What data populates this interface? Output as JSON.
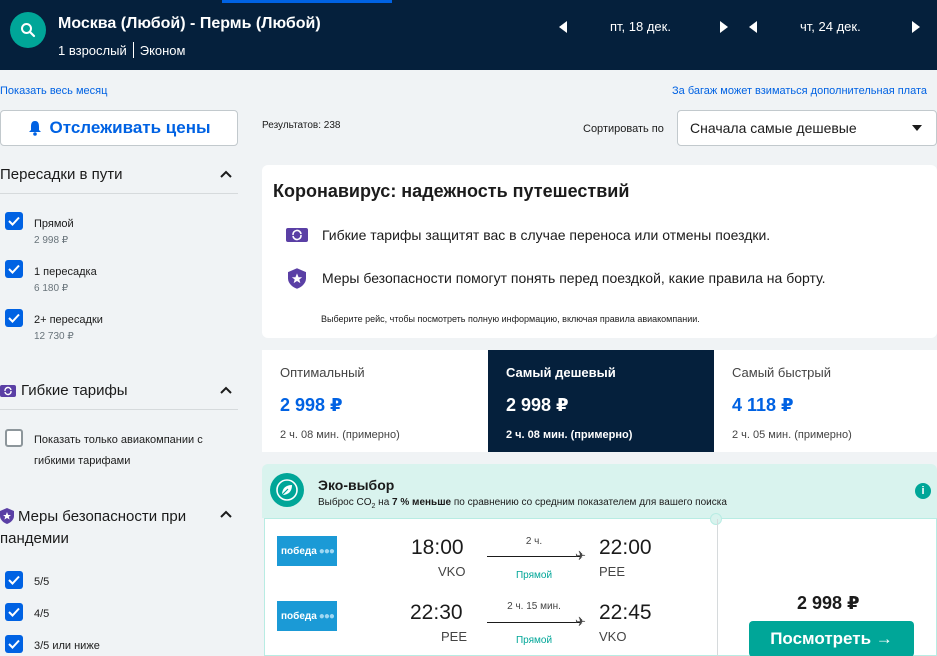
{
  "header": {
    "route": "Москва (Любой) - Пермь (Любой)",
    "passengers": "1 взрослый",
    "cabin": "Эконом",
    "depart_date": "пт, 18 дек.",
    "return_date": "чт, 24 дек."
  },
  "links": {
    "show_month": "Показать весь месяц",
    "baggage_note": "За багаж может взиматься дополнительная плата"
  },
  "filters": {
    "track_prices": "Отслеживать цены",
    "stops": {
      "title": "Пересадки в пути",
      "options": [
        {
          "label": "Прямой",
          "price": "2 998 ₽"
        },
        {
          "label": "1 пересадка",
          "price": "6 180 ₽"
        },
        {
          "label": "2+ пересадки",
          "price": "12 730 ₽"
        }
      ]
    },
    "flex": {
      "title": "Гибкие тарифы",
      "option_line1": "Показать только авиакомпании с",
      "option_line2": "гибкими тарифами"
    },
    "safety": {
      "title_line1": "Меры безопасности при",
      "title_line2": "пандемии",
      "options": [
        "5/5",
        "4/5",
        "3/5 или ниже"
      ]
    }
  },
  "results": {
    "count": "Результатов: 238",
    "sort_label": "Сортировать по",
    "sort_value": "Сначала самые дешевые"
  },
  "covid": {
    "title": "Коронавирус: надежность путешествий",
    "row1": "Гибкие тарифы защитят вас в случае переноса или отмены поездки.",
    "row2": "Меры безопасности помогут понять перед поездкой, какие правила на борту.",
    "note": "Выберите рейс, чтобы посмотреть полную информацию, включая правила авиакомпании."
  },
  "sort_tabs": [
    {
      "label": "Оптимальный",
      "price": "2 998 ₽",
      "duration": "2 ч. 08 мин. (примерно)",
      "active": false
    },
    {
      "label": "Самый дешевый",
      "price": "2 998 ₽",
      "duration": "2 ч. 08 мин. (примерно)",
      "active": true
    },
    {
      "label": "Самый быстрый",
      "price": "4 118 ₽",
      "duration": "2 ч. 05 мин. (примерно)",
      "active": false
    }
  ],
  "eco": {
    "title": "Эко-выбор",
    "desc_pre": "Выброс CO",
    "desc_sub": "2",
    "desc_mid": " на ",
    "desc_bold": "7 % меньше",
    "desc_post": " по сравнению со средним показателем для вашего поиска",
    "info": "i"
  },
  "flight": {
    "airline": "победа",
    "legs": [
      {
        "dep_time": "18:00",
        "dep_code": "VKO",
        "duration": "2 ч.",
        "stops": "Прямой",
        "arr_time": "22:00",
        "arr_code": "PEE"
      },
      {
        "dep_time": "22:30",
        "dep_code": "PEE",
        "duration": "2 ч. 15 мин.",
        "stops": "Прямой",
        "arr_time": "22:45",
        "arr_code": "VKO"
      }
    ],
    "price": "2 998 ₽",
    "button": "Посмотреть →"
  },
  "colors": {
    "header_bg": "#05203c",
    "accent_blue": "#0062e3",
    "teal": "#00a698",
    "eco_bg": "#d9f3ee"
  }
}
